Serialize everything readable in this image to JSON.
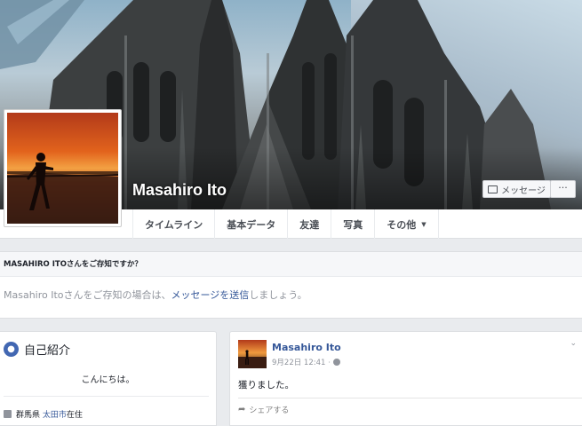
{
  "profile": {
    "name": "Masahiro Ito"
  },
  "actions": {
    "message_label": "メッセージ",
    "more_label": "···"
  },
  "tabs": [
    {
      "label": "タイムライン"
    },
    {
      "label": "基本データ"
    },
    {
      "label": "友達"
    },
    {
      "label": "写真"
    },
    {
      "label": "その他",
      "caret": "▼"
    }
  ],
  "know_box": {
    "heading": "MASAHIRO ITOさんをご存知ですか？",
    "text_before": "Masahiro Itoさんをご存知の場合は、",
    "link": "メッセージを送信",
    "text_after": "しましょう。"
  },
  "intro": {
    "title": "自己紹介",
    "greeting": "こんにちは。",
    "location_prefix": "群馬県 ",
    "location_link": "太田市",
    "location_suffix": "在住"
  },
  "post": {
    "author": "Masahiro Ito",
    "date": "9月22日 12:41",
    "separator": "·",
    "text": "獲りました。",
    "share_label": "シェアする",
    "chevron": "⌄"
  },
  "icons": {
    "globe": "globe-icon",
    "share": "share-icon",
    "location": "location-icon",
    "message": "message-icon"
  },
  "colors": {
    "link": "#365899",
    "brand": "#4267b2",
    "background": "#e9ebee"
  }
}
